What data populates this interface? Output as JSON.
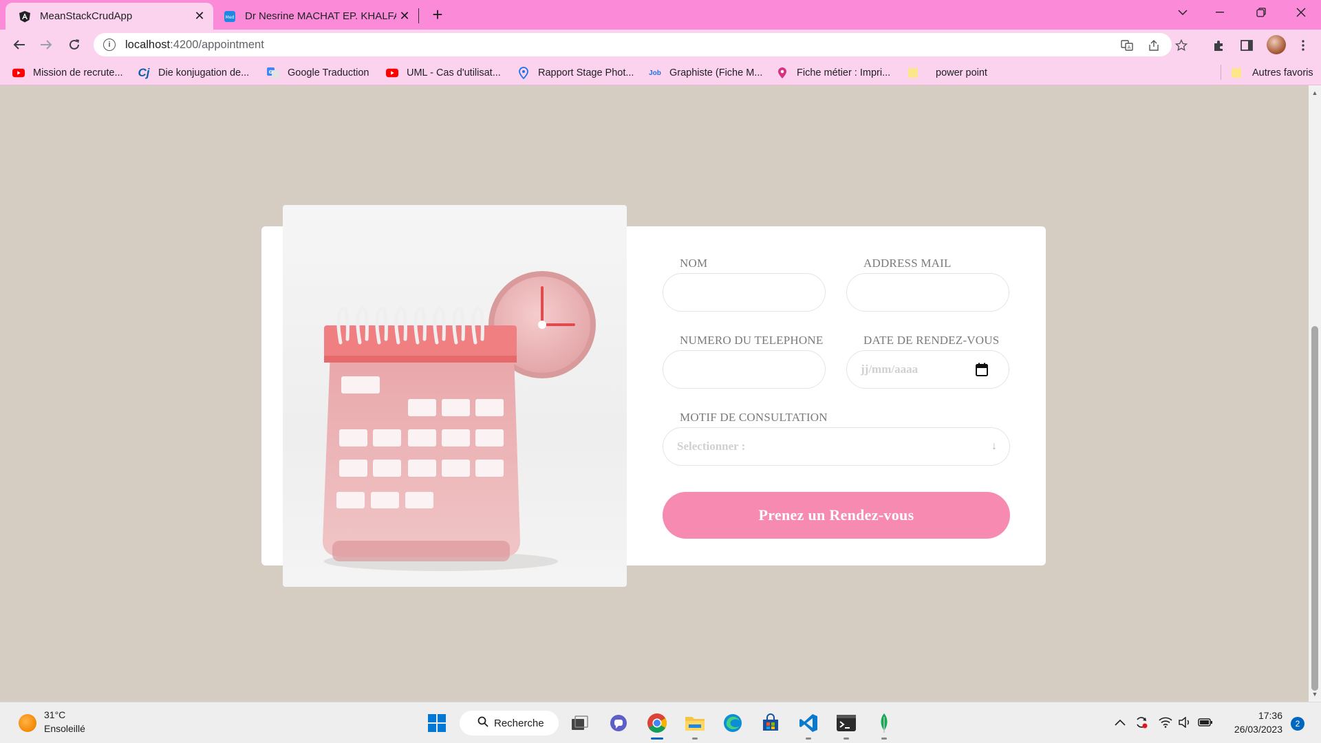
{
  "browser": {
    "tabs": [
      {
        "title": "MeanStackCrudApp",
        "icon": "angular-icon",
        "active": true
      },
      {
        "title": "Dr Nesrine MACHAT EP. KHALFALLAH",
        "icon": "med-site-icon",
        "active": false
      }
    ],
    "address": {
      "host": "localhost",
      "path": ":4200/appointment"
    },
    "bookmarks": [
      {
        "label": "Mission de recrute...",
        "icon": "youtube-icon"
      },
      {
        "label": "Die konjugation de...",
        "icon": "cj-icon"
      },
      {
        "label": "Google Traduction",
        "icon": "google-translate-icon"
      },
      {
        "label": "UML - Cas d'utilisat...",
        "icon": "youtube-icon"
      },
      {
        "label": "Rapport Stage Phot...",
        "icon": "location-pin-icon"
      },
      {
        "label": "Graphiste (Fiche M...",
        "icon": "job-icon"
      },
      {
        "label": "Fiche métier : Impri...",
        "icon": "map-pin-icon"
      },
      {
        "label": "power point",
        "icon": "folder-icon"
      }
    ],
    "other_bookmarks": "Autres favoris"
  },
  "form": {
    "nom_label": "NOM",
    "email_label": "ADDRESS MAIL",
    "phone_label": "NUMERO DU TELEPHONE",
    "date_label": "DATE DE RENDEZ-VOUS",
    "date_placeholder": "jj/mm/aaaa",
    "motif_label": "MOTIF DE CONSULTATION",
    "motif_placeholder": "Selectionner :",
    "submit_label": "Prenez un Rendez-vous"
  },
  "taskbar": {
    "weather_temp": "31°C",
    "weather_desc": "Ensoleillé",
    "search_label": "Recherche",
    "time": "17:36",
    "date": "26/03/2023",
    "notification_count": "2"
  },
  "colors": {
    "tab_bar": "#fb8bd8",
    "toolbar": "#fcd3ef",
    "page_bg": "#d6cdc2",
    "button": "#f68ab1"
  }
}
